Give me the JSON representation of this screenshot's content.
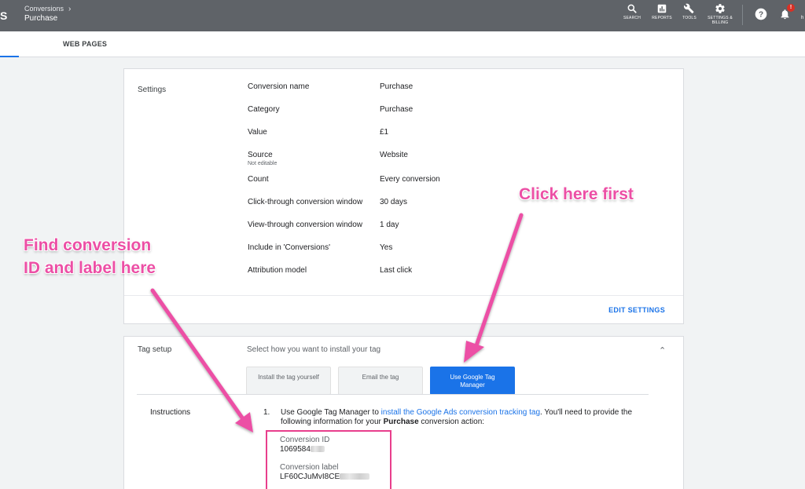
{
  "topbar": {
    "edge_letter": "S",
    "breadcrumb": "Conversions",
    "breadcrumb_chevron": "›",
    "page_title": "Purchase",
    "actions": [
      {
        "label": "SEARCH",
        "icon": "search-icon"
      },
      {
        "label": "REPORTS",
        "icon": "reports-icon"
      },
      {
        "label": "TOOLS",
        "icon": "tools-icon"
      },
      {
        "label_line1": "SETTINGS &",
        "label_line2": "BILLING",
        "icon": "gear-icon"
      }
    ],
    "notification_badge": "!",
    "help_icon": "help-icon",
    "bell_icon": "bell-icon"
  },
  "subheader": {
    "tab_label": "WEB PAGES"
  },
  "settings": {
    "title": "Settings",
    "rows": [
      {
        "key": "Conversion name",
        "value": "Purchase",
        "note": ""
      },
      {
        "key": "Category",
        "value": "Purchase",
        "note": ""
      },
      {
        "key": "Value",
        "value": "£1",
        "note": ""
      },
      {
        "key": "Source",
        "value": "Website",
        "note": "Not editable"
      },
      {
        "key": "Count",
        "value": "Every conversion",
        "note": ""
      },
      {
        "key": "Click-through conversion window",
        "value": "30 days",
        "note": ""
      },
      {
        "key": "View-through conversion window",
        "value": "1 day",
        "note": ""
      },
      {
        "key": "Include in 'Conversions'",
        "value": "Yes",
        "note": ""
      },
      {
        "key": "Attribution model",
        "value": "Last click",
        "note": ""
      }
    ],
    "edit_label": "EDIT SETTINGS"
  },
  "tag_setup": {
    "title": "Tag setup",
    "prompt": "Select how you want to install your tag",
    "collapse_glyph": "⌃",
    "options": [
      {
        "label": "Install the tag yourself",
        "active": false
      },
      {
        "label": "Email the tag",
        "active": false
      },
      {
        "label": "Use Google Tag Manager",
        "active": true
      }
    ],
    "instructions_label": "Instructions",
    "step_number": "1.",
    "step_text_before": "Use Google Tag Manager to ",
    "step_link": "install the Google Ads conversion tracking tag",
    "step_text_middle": ". You'll need to provide the following information for your ",
    "step_bold": "Purchase",
    "step_text_after": " conversion action:",
    "conversion_id_label": "Conversion ID",
    "conversion_id_value": "1069584",
    "conversion_label_label": "Conversion label",
    "conversion_label_value": "LF60CJuMvI8CE"
  },
  "annotations": {
    "click_here": "Click here first",
    "find_line1": "Find conversion",
    "find_line2": "ID and label here",
    "color": "#ec4fa5"
  },
  "colors": {
    "topbar": "#5f6368",
    "accent": "#1a73e8",
    "highlight_box": "#e83e8c"
  }
}
